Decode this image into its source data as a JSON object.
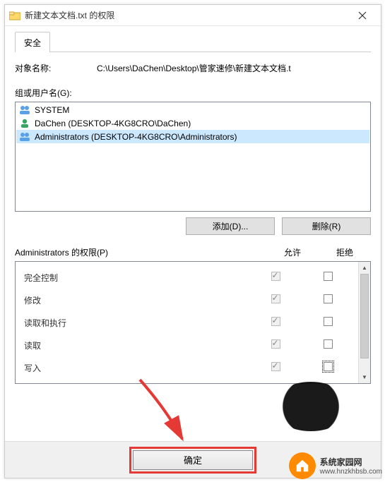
{
  "title": "新建文本文档.txt 的权限",
  "tabs": {
    "security": "安全"
  },
  "object": {
    "label": "对象名称:",
    "value": "C:\\Users\\DaChen\\Desktop\\管家速修\\新建文本文档.t"
  },
  "groups": {
    "label": "组或用户名(G):",
    "items": [
      {
        "kind": "group",
        "name": "SYSTEM"
      },
      {
        "kind": "user",
        "name": "DaChen (DESKTOP-4KG8CRO\\DaChen)"
      },
      {
        "kind": "group",
        "name": "Administrators (DESKTOP-4KG8CRO\\Administrators)"
      }
    ],
    "selected_index": 2
  },
  "buttons": {
    "add": "添加(D)...",
    "remove": "删除(R)",
    "ok": "确定"
  },
  "perm": {
    "header": "Administrators 的权限(P)",
    "allow": "允许",
    "deny": "拒绝",
    "rows": [
      {
        "name": "完全控制",
        "allow_checked": true,
        "allow_gray": true
      },
      {
        "name": "修改",
        "allow_checked": true,
        "allow_gray": true
      },
      {
        "name": "读取和执行",
        "allow_checked": true,
        "allow_gray": true
      },
      {
        "name": "读取",
        "allow_checked": true,
        "allow_gray": true
      },
      {
        "name": "写入",
        "allow_checked": true,
        "allow_gray": true,
        "deny_focus": true
      }
    ]
  },
  "watermark": {
    "brand": "系统家园网",
    "url": "www.hnzkhbsb.com"
  }
}
